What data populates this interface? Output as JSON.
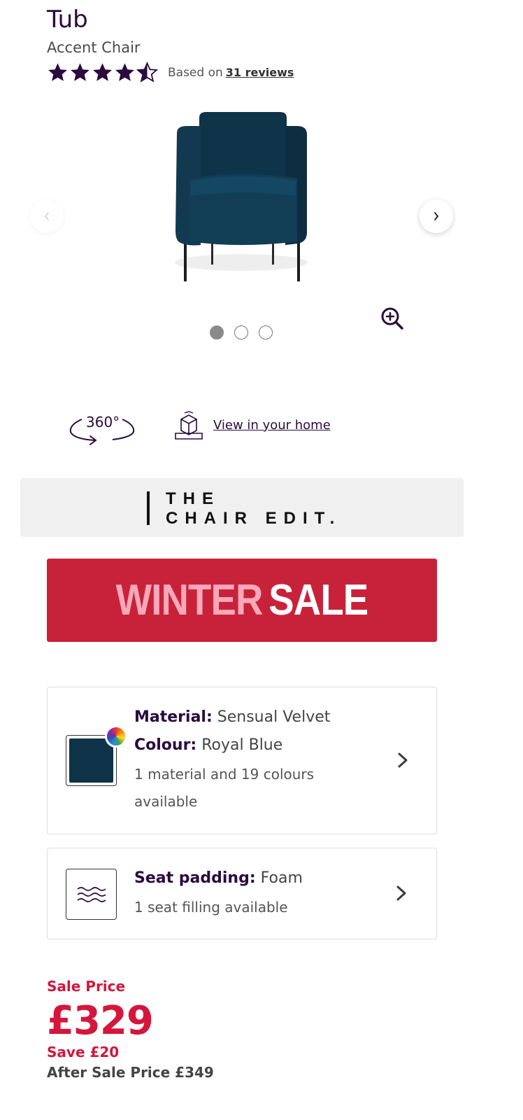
{
  "product": {
    "title": "Tub",
    "subtitle": "Accent Chair",
    "rating": 4.5,
    "rating_max": 5,
    "reviews_prefix": "Based on",
    "reviews_link": "31 reviews"
  },
  "gallery": {
    "image": "chair-image",
    "current_slide": 1,
    "total_slides": 3
  },
  "viewers": {
    "label_360": "360°",
    "view_in_home": "View in your home"
  },
  "chair_edit": {
    "line1": "THE",
    "line2": "CHAIR EDIT."
  },
  "sale_banner": {
    "word1": "WINTER",
    "word2": "SALE",
    "colors": {
      "background": "#c8223a",
      "word1": "#f8a8b8",
      "word2": "#ffffff"
    }
  },
  "material_card": {
    "material_label": "Material:",
    "material_value": "Sensual Velvet",
    "colour_label": "Colour:",
    "colour_value": "Royal Blue",
    "availability_line1": "1 material and 19 colours",
    "availability_line2": "available",
    "swatch_color": "#0f3348"
  },
  "seat_card": {
    "label": "Seat padding:",
    "value": "Foam",
    "availability": "1 seat filling available"
  },
  "pricing": {
    "sale_label": "Sale Price",
    "price": "£329",
    "save": "Save £20",
    "after_sale": "After Sale Price £349",
    "accent_color": "#d4163c"
  }
}
